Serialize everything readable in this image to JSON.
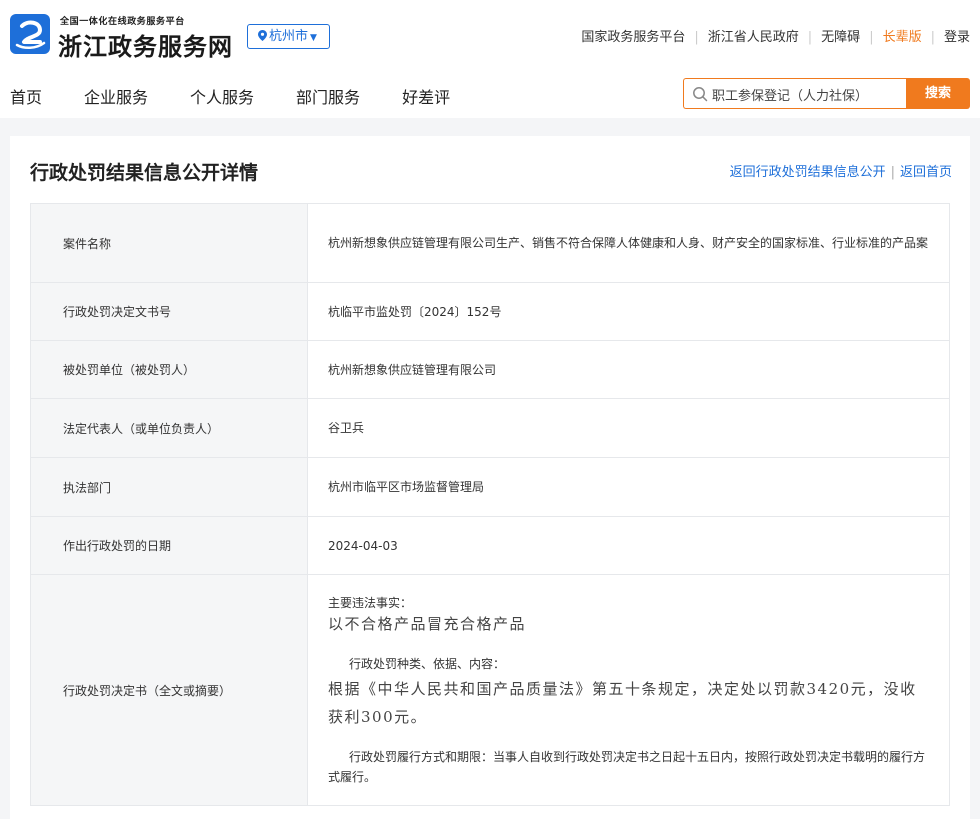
{
  "header": {
    "logo_subtitle": "全国一体化在线政务服务平台",
    "logo_title": "浙江政务服务网",
    "city": "杭州市",
    "top_links": [
      "国家政务服务平台",
      "浙江省人民政府",
      "无障碍",
      "长辈版",
      "登录"
    ]
  },
  "nav": {
    "items": [
      "首页",
      "企业服务",
      "个人服务",
      "部门服务",
      "好差评"
    ]
  },
  "search": {
    "value": "职工参保登记（人力社保）",
    "button": "搜索"
  },
  "page": {
    "title": "行政处罚结果信息公开详情",
    "back_links": [
      "返回行政处罚结果信息公开",
      "返回首页"
    ]
  },
  "detail": {
    "rows": [
      {
        "label": "案件名称",
        "value": "杭州新想象供应链管理有限公司生产、销售不符合保障人体健康和人身、财产安全的国家标准、行业标准的产品案"
      },
      {
        "label": "行政处罚决定文书号",
        "value": "杭临平市监处罚〔2024〕152号"
      },
      {
        "label": "被处罚单位（被处罚人）",
        "value": "杭州新想象供应链管理有限公司"
      },
      {
        "label": "法定代表人（或单位负责人）",
        "value": "谷卫兵"
      },
      {
        "label": "执法部门",
        "value": "杭州市临平区市场监督管理局"
      },
      {
        "label": "作出行政处罚的日期",
        "value": "2024-04-03"
      }
    ],
    "decision": {
      "label": "行政处罚决定书（全文或摘要）",
      "facts_heading": "主要违法事实：",
      "facts_text": "以不合格产品冒充合格产品",
      "basis_heading": "行政处罚种类、依据、内容：",
      "basis_text": "根据《中华人民共和国产品质量法》第五十条规定，决定处以罚款3420元，没收获利300元。",
      "method_text": "行政处罚履行方式和期限：当事人自收到行政处罚决定书之日起十五日内，按照行政处罚决定书载明的履行方式履行。"
    }
  },
  "colors": {
    "brand_blue": "#1e6fd9",
    "accent_orange": "#f07a1e"
  }
}
